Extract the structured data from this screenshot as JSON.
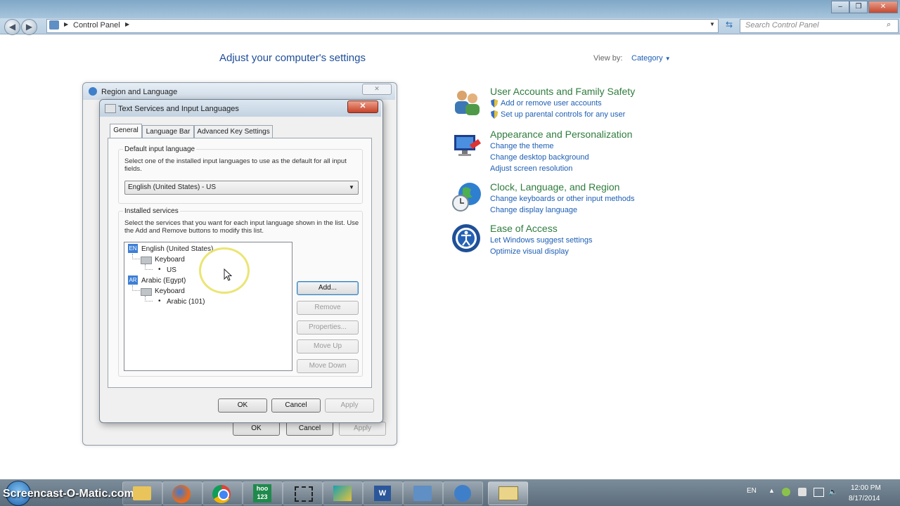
{
  "explorer": {
    "address": "Control Panel",
    "search_placeholder": "Search Control Panel"
  },
  "control_panel": {
    "heading": "Adjust your computer's settings",
    "view_by_label": "View by:",
    "view_by_value": "Category",
    "categories": [
      {
        "title": "User Accounts and Family Safety",
        "links": [
          "Add or remove user accounts",
          "Set up parental controls for any user"
        ],
        "icon": "users-icon"
      },
      {
        "title": "Appearance and Personalization",
        "links": [
          "Change the theme",
          "Change desktop background",
          "Adjust screen resolution"
        ],
        "icon": "display-icon"
      },
      {
        "title": "Clock, Language, and Region",
        "links": [
          "Change keyboards or other input methods",
          "Change display language"
        ],
        "icon": "globe-clock-icon"
      },
      {
        "title": "Ease of Access",
        "links": [
          "Let Windows suggest settings",
          "Optimize visual display"
        ],
        "icon": "ease-of-access-icon"
      }
    ]
  },
  "region_dialog": {
    "title": "Region and Language",
    "buttons": {
      "ok": "OK",
      "cancel": "Cancel",
      "apply": "Apply"
    }
  },
  "text_services_dialog": {
    "title": "Text Services and Input Languages",
    "tabs": [
      "General",
      "Language Bar",
      "Advanced Key Settings"
    ],
    "default_group": {
      "label": "Default input language",
      "description": "Select one of the installed input languages to use as the default for all input fields.",
      "selected": "English (United States) - US"
    },
    "services_group": {
      "label": "Installed services",
      "description": "Select the services that you want for each input language shown in the list. Use the Add and Remove buttons to modify this list."
    },
    "tree": {
      "lang1": {
        "code": "EN",
        "name": "English (United States)",
        "keyboard": "Keyboard",
        "layout": "US"
      },
      "lang2": {
        "code": "AR",
        "name": "Arabic (Egypt)",
        "keyboard": "Keyboard",
        "layout": "Arabic (101)"
      }
    },
    "side_buttons": {
      "add": "Add...",
      "remove": "Remove",
      "properties": "Properties...",
      "move_up": "Move Up",
      "move_down": "Move Down"
    },
    "buttons": {
      "ok": "OK",
      "cancel": "Cancel",
      "apply": "Apply"
    }
  },
  "taskbar": {
    "watermark": "Screencast-O-Matic.com",
    "hoo_label": "hoo 123",
    "language_indicator": "EN",
    "time": "12:00 PM",
    "date": "8/17/2014"
  }
}
